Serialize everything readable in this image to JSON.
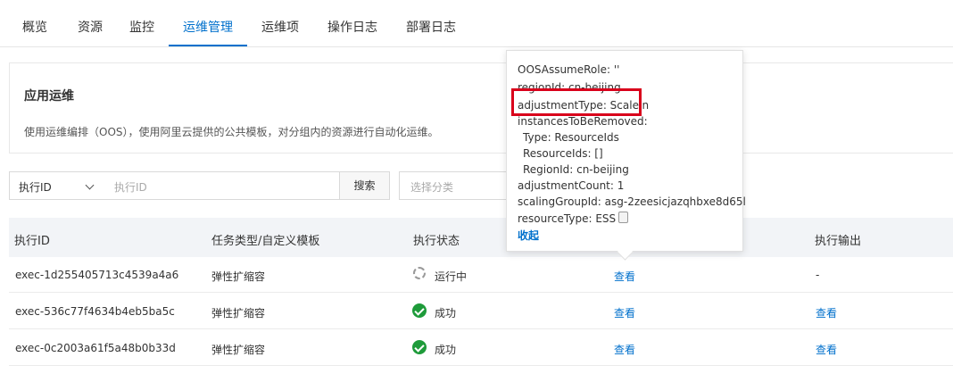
{
  "tabs": [
    {
      "label": "概览"
    },
    {
      "label": "资源"
    },
    {
      "label": "监控"
    },
    {
      "label": "运维管理"
    },
    {
      "label": "运维项"
    },
    {
      "label": "操作日志"
    },
    {
      "label": "部署日志"
    }
  ],
  "active_tab": "运维管理",
  "card": {
    "title": "应用运维",
    "description": "使用运维编排（OOS），使用阿里云提供的公共模板，对分组内的资源进行自动化运维。"
  },
  "search": {
    "select_value": "执行ID",
    "input_placeholder": "执行ID",
    "button_label": "搜索",
    "category_placeholder": "选择分类"
  },
  "table": {
    "headers": {
      "id": "执行ID",
      "type": "任务类型/自定义模板",
      "status": "执行状态",
      "output": "执行输出"
    },
    "rows": [
      {
        "id": "exec-1d255405713c4539a4a6",
        "type": "弹性扩缩容",
        "status": "运行中",
        "status_icon": "spinner-icon",
        "detail": "查看",
        "output": "-"
      },
      {
        "id": "exec-536c77f4634b4eb5ba5c",
        "type": "弹性扩缩容",
        "status": "成功",
        "status_icon": "success-check-icon",
        "detail": "查看",
        "output": "查看"
      },
      {
        "id": "exec-0c2003a61f5a48b0b33d",
        "type": "弹性扩缩容",
        "status": "成功",
        "status_icon": "success-check-icon",
        "detail": "查看",
        "output": "查看"
      }
    ]
  },
  "popover": {
    "lines": [
      "OOSAssumeRole: ''",
      "regionId: cn-beijing",
      "adjustmentType: ScaleIn",
      "instancesToBeRemoved:",
      "Type: ResourceIds",
      "ResourceIds: []",
      "RegionId: cn-beijing",
      "adjustmentCount: 1",
      "scalingGroupId: asg-2zeesicjazqhbxe8d65l",
      "resourceType: ESS"
    ],
    "collapse_label": "收起"
  },
  "colors": {
    "accent": "#0070cc",
    "success": "#1e9b3a",
    "highlight_box": "#d9001b",
    "table_header_bg": "#f2f4f7"
  }
}
